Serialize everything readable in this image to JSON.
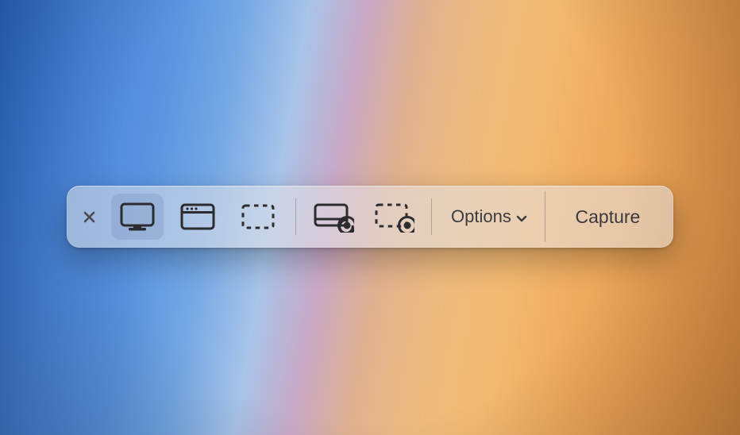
{
  "toolbar": {
    "options_label": "Options",
    "capture_label": "Capture",
    "close_icon": "close-x",
    "modes": {
      "capture_entire_screen": "screen-icon",
      "capture_window": "window-icon",
      "capture_selection": "selection-icon",
      "record_entire_screen": "record-screen-icon",
      "record_selection": "record-selection-icon"
    },
    "selected_mode": "capture_entire_screen"
  }
}
